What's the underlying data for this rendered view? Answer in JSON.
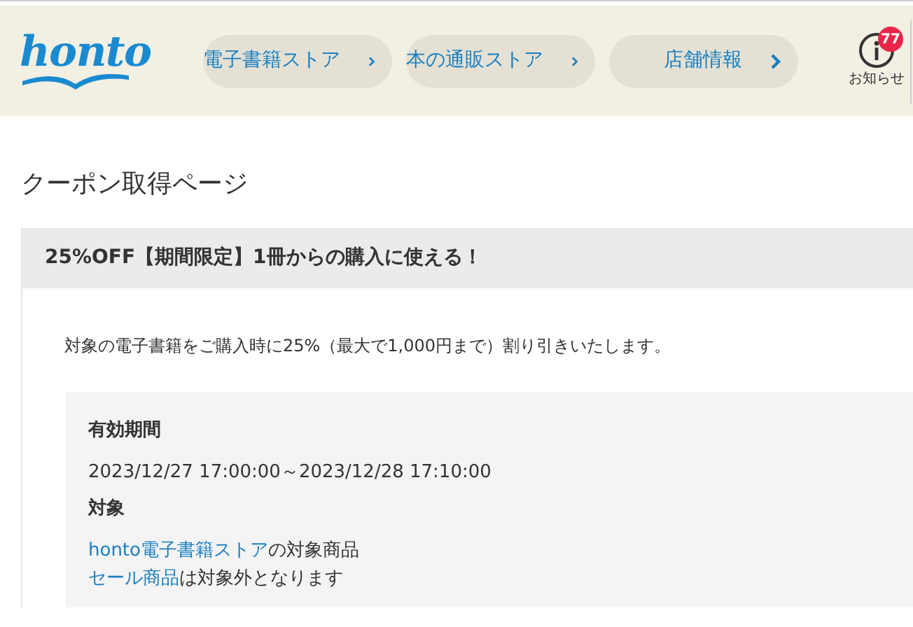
{
  "logo": "honto",
  "nav": [
    {
      "label": "電子書籍ストア"
    },
    {
      "label": "本の通販ストア"
    },
    {
      "label": "店舗情報"
    }
  ],
  "notice": {
    "badge": "77",
    "label": "お知らせ"
  },
  "page_title": "クーポン取得ページ",
  "coupon": {
    "title": "25%OFF【期間限定】1冊からの購入に使える！",
    "description": "対象の電子書籍をご購入時に25%（最大で1,000円まで）割り引きいたします。",
    "period_label": "有効期間",
    "period": "2023/12/27 17:00:00～2023/12/28 17:10:00",
    "target_label": "対象",
    "target_lines": [
      {
        "link": "honto電子書籍ストア",
        "rest": "の対象商品"
      },
      {
        "link": "セール商品",
        "rest": "は対象外となります"
      }
    ]
  }
}
